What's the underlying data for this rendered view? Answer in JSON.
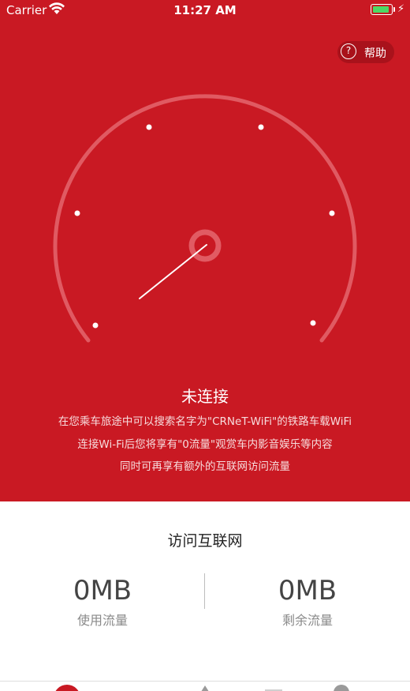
{
  "status_bar": {
    "carrier": "Carrier",
    "time": "11:27 AM",
    "battery_level": 0.9,
    "battery_color": "#4cd964"
  },
  "help": {
    "icon": "question-circle-icon",
    "label": "帮助"
  },
  "gauge": {
    "type": "speedometer-gauge",
    "tick_count": 6,
    "needle_value": 0
  },
  "connection": {
    "status": "未连接",
    "desc_line_1": "在您乘车旅途中可以搜索名字为\"CRNeT-WiFi\"的铁路车载WiFi",
    "desc_line_2": "连接Wi-Fi后您将享有\"0流量\"观赏车内影音娱乐等内容",
    "desc_line_3": "同时可再享有额外的互联网访问流量"
  },
  "internet": {
    "title": "访问互联网",
    "used_value": "0MB",
    "used_label": "使用流量",
    "remaining_value": "0MB",
    "remaining_label": "剩余流量"
  },
  "colors": {
    "primary_red": "#c91923",
    "white": "#ffffff"
  }
}
